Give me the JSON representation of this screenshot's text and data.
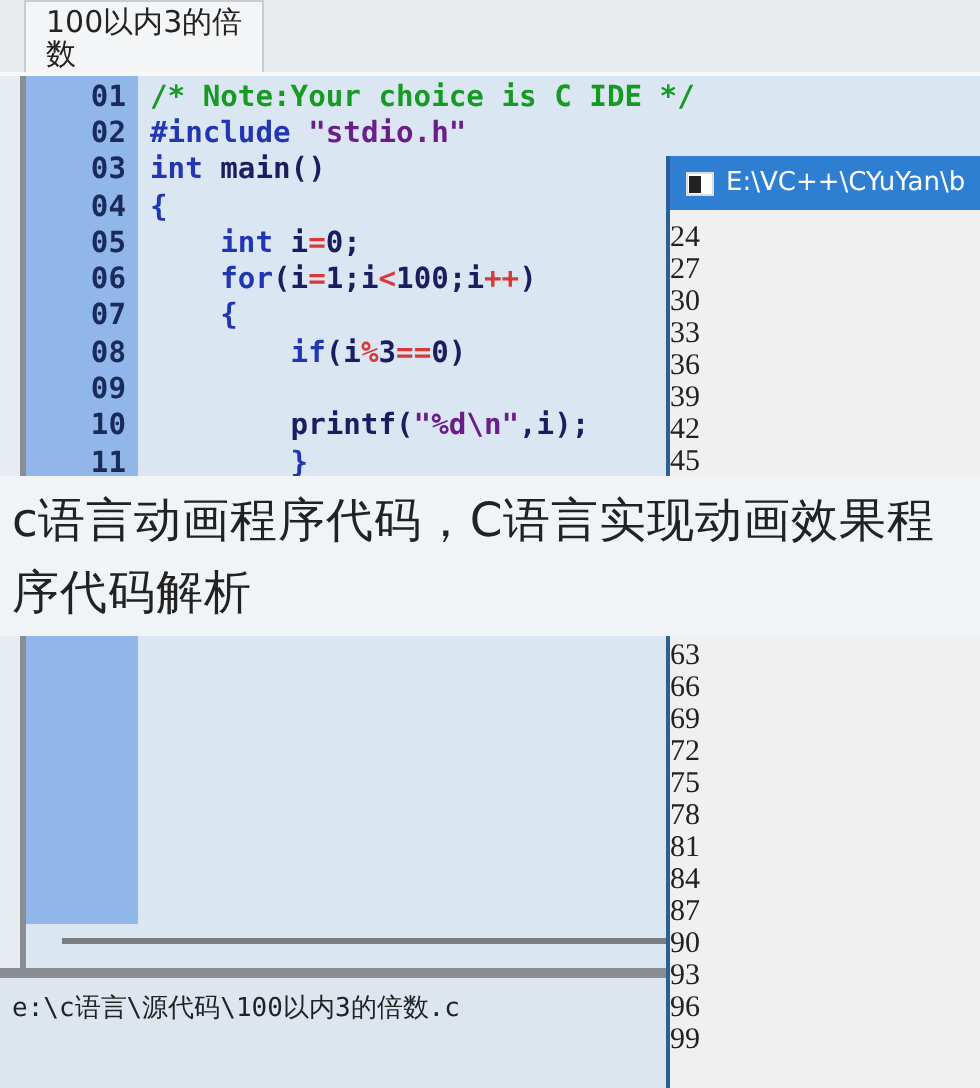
{
  "editor": {
    "tab": {
      "label": "100以内3的倍数",
      "selected": true
    },
    "lines": [
      {
        "number": "01",
        "tokens": [
          {
            "kind": "comment",
            "text": "/* Note:Your choice is C IDE */"
          }
        ]
      },
      {
        "number": "02",
        "tokens": [
          {
            "kind": "keyword",
            "text": "#include"
          },
          {
            "kind": "string",
            "text": " \"stdio.h\""
          }
        ]
      },
      {
        "number": "03",
        "tokens": [
          {
            "kind": "keyword",
            "text": "int"
          },
          {
            "kind": "plain",
            "text": " main()"
          }
        ]
      },
      {
        "number": "04",
        "tokens": [
          {
            "kind": "keyword",
            "text": "{"
          }
        ]
      },
      {
        "number": "05",
        "tokens": [
          {
            "kind": "keyword",
            "text": "    int"
          },
          {
            "kind": "plain",
            "text": " i"
          },
          {
            "kind": "operator",
            "text": "="
          },
          {
            "kind": "plain",
            "text": "0;"
          }
        ]
      },
      {
        "number": "06",
        "tokens": [
          {
            "kind": "keyword",
            "text": "    for"
          },
          {
            "kind": "plain",
            "text": "(i"
          },
          {
            "kind": "operator",
            "text": "="
          },
          {
            "kind": "plain",
            "text": "1;i"
          },
          {
            "kind": "operator",
            "text": "<"
          },
          {
            "kind": "plain",
            "text": "100;i"
          },
          {
            "kind": "operator",
            "text": "++"
          },
          {
            "kind": "plain",
            "text": ")"
          }
        ]
      },
      {
        "number": "07",
        "tokens": [
          {
            "kind": "keyword",
            "text": "    {"
          }
        ]
      },
      {
        "number": "08",
        "tokens": [
          {
            "kind": "keyword",
            "text": "        if"
          },
          {
            "kind": "plain",
            "text": "(i"
          },
          {
            "kind": "operator",
            "text": "%"
          },
          {
            "kind": "plain",
            "text": "3"
          },
          {
            "kind": "operator",
            "text": "=="
          },
          {
            "kind": "plain",
            "text": "0)"
          }
        ]
      },
      {
        "number": "09"
      },
      {
        "number": "10",
        "tokens": [
          {
            "kind": "plain",
            "text": "        printf("
          },
          {
            "kind": "string",
            "text": "\"%d\\n\""
          },
          {
            "kind": "plain",
            "text": ",i);"
          }
        ]
      },
      {
        "number": "11",
        "tokens": [
          {
            "kind": "keyword",
            "text": "        }"
          }
        ]
      }
    ]
  },
  "status_bar": {
    "path": "e:\\c语言\\源代码\\100以内3的倍数.c"
  },
  "console": {
    "title": "E:\\VC++\\CYuYan\\b",
    "output_above_caption": [
      "24",
      "27",
      "30",
      "33",
      "36",
      "39",
      "42",
      "45"
    ],
    "output_below_caption": [
      "63",
      "66",
      "69",
      "72",
      "75",
      "78",
      "81",
      "84",
      "87",
      "90",
      "93",
      "96",
      "99"
    ]
  },
  "caption": "c语言动画程序代码，C语言实现动画效果程序代码解析"
}
